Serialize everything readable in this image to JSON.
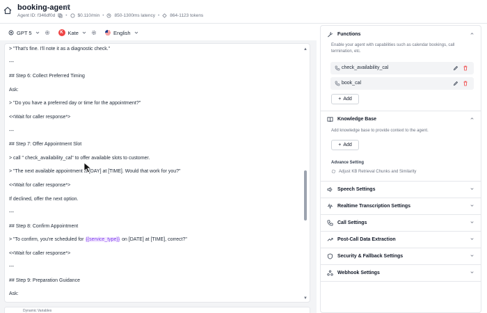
{
  "header": {
    "agent_name": "booking-agent",
    "agent_id": "Agent ID: f346df0d",
    "cost": "$0.110/min",
    "latency": "850-1300ms latency",
    "tokens": "864-1123 tokens"
  },
  "toolbar": {
    "model": "GPT 5",
    "voice": "Kate",
    "voice_initial": "K",
    "language": "English"
  },
  "editor": {
    "lines": [
      "> \"That's fine. I'll note it as a diagnostic check.\"",
      "---",
      "## Step 6: Collect Preferred Timing",
      "Ask:",
      "> \"Do you have a preferred day or time for the appointment?\"",
      "<<Wait for caller response*>",
      "---",
      "## Step 7: Offer Appointment Slot",
      "> call \" check_availability_cal\" to offer available slots to customer.",
      "> \"The next available appointment is [DAY] at [TIME]. Would that work for you?\"",
      "<<Wait for caller response*>",
      "If declined, offer the next option.",
      "---",
      "## Step 8: Confirm Appointment",
      "> \"To confirm, you're scheduled for ",
      "---",
      "## Step 9: Preparation Guidance",
      "Ask:"
    ],
    "confirm_var": "{{service_type}}",
    "confirm_rest": " on [DATE] at [TIME], correct?\"",
    "wait_line_8": "<<Wait for caller response*>",
    "bottom_label": "Dynamic Variables"
  },
  "panel": {
    "functions_title": "Functions",
    "functions_desc": "Enable your agent with capabilities such as calendar bookings, call termination, etc.",
    "functions": [
      {
        "name": "check_availability_cal"
      },
      {
        "name": "book_cal"
      }
    ],
    "add_label": "Add",
    "kb_title": "Knowledge Base",
    "kb_desc": "Add knowledge base to provide context to the agent.",
    "advance_setting": "Advance Setting",
    "advance_item": "Adjust KB Retrieval Chunks and Similarity",
    "sections": [
      "Speech Settings",
      "Realtime Transcription Settings",
      "Call Settings",
      "Post-Call Data Extraction",
      "Security & Fallback Settings",
      "Webhook Settings"
    ]
  },
  "colors": {
    "accent_purple": "#7c3aed",
    "danger": "#ef4444",
    "avatar": "#ef4444"
  }
}
